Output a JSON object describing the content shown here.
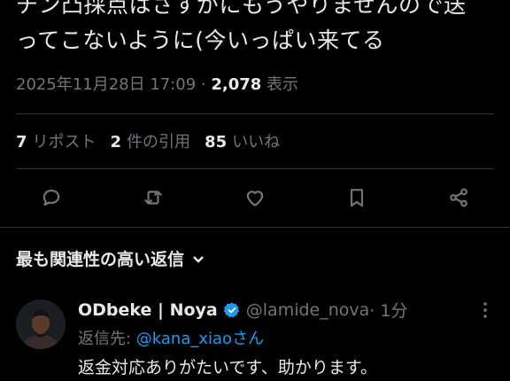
{
  "tweet": {
    "line1": "チン凸採点はさすがにもうやりませんので送",
    "line2": "ってこないように(今いっぱい来てる",
    "date": "2025年11月28日 17:09",
    "sep": " · ",
    "views": "2,078",
    "views_label": " 表示"
  },
  "stats": {
    "reposts_count": "7",
    "reposts_label": "リポスト",
    "quotes_count": "2",
    "quotes_label": "件の引用",
    "likes_count": "85",
    "likes_label": "いいね"
  },
  "actions": {
    "reply_icon": "reply-icon",
    "repost_icon": "repost-icon",
    "like_icon": "heart-icon",
    "bookmark_icon": "bookmark-icon",
    "share_icon": "share-icon"
  },
  "sort": {
    "label": "最も関連性の高い返信"
  },
  "reply": {
    "name": "ODbeke | Noya",
    "handle": "@lamide_nova",
    "time": " · 1分",
    "reply_to_prefix": "返信先: ",
    "reply_to_handle": "@kana_xiao",
    "reply_to_suffix": "さん",
    "body": "返金対応ありがたいです、助かります。"
  },
  "colors": {
    "background": "#000000",
    "text": "#e7e9ea",
    "muted": "#71767b",
    "accent": "#1d9bf0",
    "divider": "#2f3336"
  }
}
